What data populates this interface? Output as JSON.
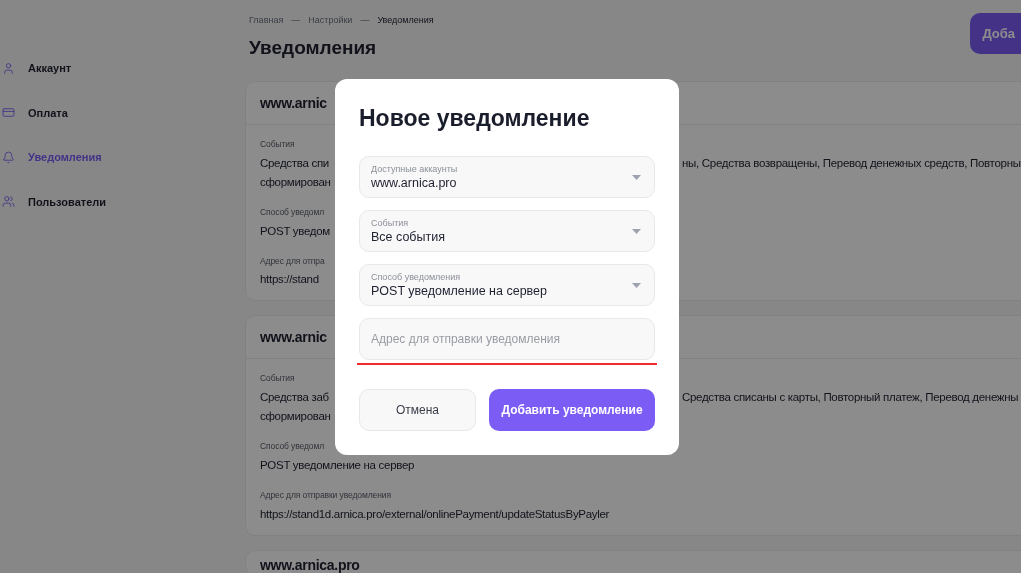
{
  "sidebar": {
    "items": [
      {
        "label": "Аккаунт",
        "selected": false
      },
      {
        "label": "Оплата",
        "selected": false
      },
      {
        "label": "Уведомления",
        "selected": true
      },
      {
        "label": "Пользователи",
        "selected": false
      }
    ]
  },
  "breadcrumbs": [
    {
      "label": "Главная",
      "current": false
    },
    {
      "label": "Настройки",
      "current": false
    },
    {
      "label": "Уведомления",
      "current": true
    }
  ],
  "breadcrumb_separator": "—",
  "page_title": "Уведомления",
  "header_button": "Доба",
  "cards": [
    {
      "title": "www.arnic",
      "fields": [
        {
          "label": {
            "left": "События"
          },
          "lines": [
            {
              "left": "Средства спи",
              "right": "ны, Средства возвращены, Перевод денежных средств, Повторны"
            },
            {
              "left": "сформирован"
            }
          ]
        },
        {
          "label": {
            "left": "Способ уведомл"
          },
          "lines": [
            {
              "left": "POST уведом"
            }
          ]
        },
        {
          "label": {
            "left": "Адрес для отпра"
          },
          "lines": [
            {
              "left": "https://stand"
            }
          ]
        }
      ]
    },
    {
      "title": "www.arnic",
      "fields": [
        {
          "label": {
            "left": "События"
          },
          "lines": [
            {
              "left": "Средства заб",
              "right": "Средства списаны с карты, Повторный платеж, Перевод денежны"
            },
            {
              "left": "сформирован"
            }
          ]
        },
        {
          "label": {
            "left": "Способ уведомл"
          },
          "lines": [
            {
              "text": "POST уведомление на сервер"
            }
          ]
        },
        {
          "label": {
            "text": "Адрес для отправки уведомления"
          },
          "lines": [
            {
              "text": "https://stand1d.arnica.pro/external/onlinePayment/updateStatusByPayler"
            }
          ]
        }
      ]
    },
    {
      "title": "www.arnica.pro"
    }
  ],
  "modal": {
    "title": "Новое уведомление",
    "fields": [
      {
        "kind": "select",
        "label": "Доступные аккаунты",
        "value": "www.arnica.pro"
      },
      {
        "kind": "select",
        "label": "События",
        "value": "Все события"
      },
      {
        "kind": "select",
        "label": "Способ уведомления",
        "value": "POST уведомление на сервер"
      },
      {
        "kind": "input",
        "placeholder": "Адрес для отправки уведомления",
        "error": true
      }
    ],
    "buttons": [
      {
        "label": "Отмена",
        "kind": "secondary"
      },
      {
        "label": "Добавить уведомление",
        "kind": "primary"
      }
    ]
  }
}
